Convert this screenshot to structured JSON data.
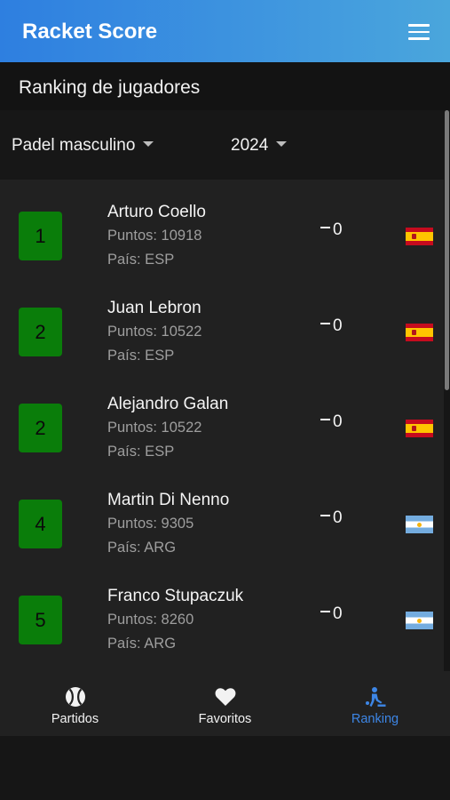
{
  "app": {
    "title": "Racket Score"
  },
  "section": {
    "title": "Ranking de jugadores"
  },
  "filters": {
    "category": "Padel masculino",
    "year": "2024"
  },
  "players": [
    {
      "position": "1",
      "name": "Arturo Coello",
      "points": "Puntos: 10918",
      "country": "País: ESP",
      "trend": "0",
      "flag": "spain-flag"
    },
    {
      "position": "2",
      "name": "Juan Lebron",
      "points": "Puntos: 10522",
      "country": "País: ESP",
      "trend": "0",
      "flag": "spain-flag"
    },
    {
      "position": "2",
      "name": "Alejandro Galan",
      "points": "Puntos: 10522",
      "country": "País: ESP",
      "trend": "0",
      "flag": "spain-flag"
    },
    {
      "position": "4",
      "name": "Martin Di Nenno",
      "points": "Puntos: 9305",
      "country": "País: ARG",
      "trend": "0",
      "flag": "argentina-flag"
    },
    {
      "position": "5",
      "name": "Franco Stupaczuk",
      "points": "Puntos: 8260",
      "country": "País: ARG",
      "trend": "0",
      "flag": "argentina-flag"
    }
  ],
  "nav": {
    "items": [
      {
        "label": "Partidos",
        "icon": "tennis-ball-icon",
        "active": false
      },
      {
        "label": "Favoritos",
        "icon": "heart-icon",
        "active": false
      },
      {
        "label": "Ranking",
        "icon": "player-ranking-icon",
        "active": true
      }
    ]
  },
  "colors": {
    "accent": "#3d86e6",
    "badge": "#0a7d0a",
    "appbar_start": "#2e7fe0",
    "appbar_end": "#4aa6dc"
  }
}
